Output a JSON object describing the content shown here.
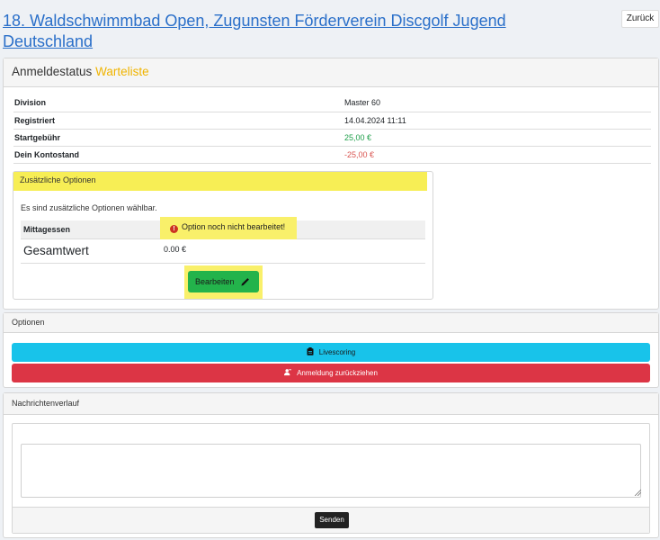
{
  "header": {
    "title": "18. Waldschwimmbad Open, Zugunsten Förderverein Discgolf Jugend Deutschland",
    "back_label": "Zurück"
  },
  "status_card": {
    "title_prefix": "Anmeldestatus",
    "status": "Warteliste",
    "rows": [
      {
        "label": "Division",
        "value": "Master 60"
      },
      {
        "label": "Registriert",
        "value": "14.04.2024 11:11"
      },
      {
        "label": "Startgebühr",
        "value": "25,00 €"
      },
      {
        "label": "Dein Kontostand",
        "value": "-25,00 €"
      }
    ],
    "colors": {
      "status": "#f0b400",
      "fee": "#1f9f4a",
      "balance": "#d9534f"
    }
  },
  "additional_options": {
    "title": "Zusätzliche Optionen",
    "description": "Es sind zusätzliche Optionen wählbar.",
    "option_name": "Mittagessen",
    "option_status": "Option noch nicht bearbeitet!",
    "warning_icon": "exclamation-circle-icon",
    "total_label": "Gesamtwert",
    "total_value": "0.00 €",
    "edit_label": "Bearbeiten",
    "edit_icon": "pencil-icon"
  },
  "options_card": {
    "title": "Optionen",
    "livescoring_label": "Livescoring",
    "livescoring_icon": "clipboard-icon",
    "withdraw_label": "Anmeldung zurückziehen",
    "withdraw_icon": "user-minus-icon",
    "colors": {
      "livescoring": "#18c3ea",
      "withdraw": "#dc3545"
    }
  },
  "messages_card": {
    "title": "Nachrichtenverlauf",
    "message_value": "",
    "send_label": "Senden"
  }
}
